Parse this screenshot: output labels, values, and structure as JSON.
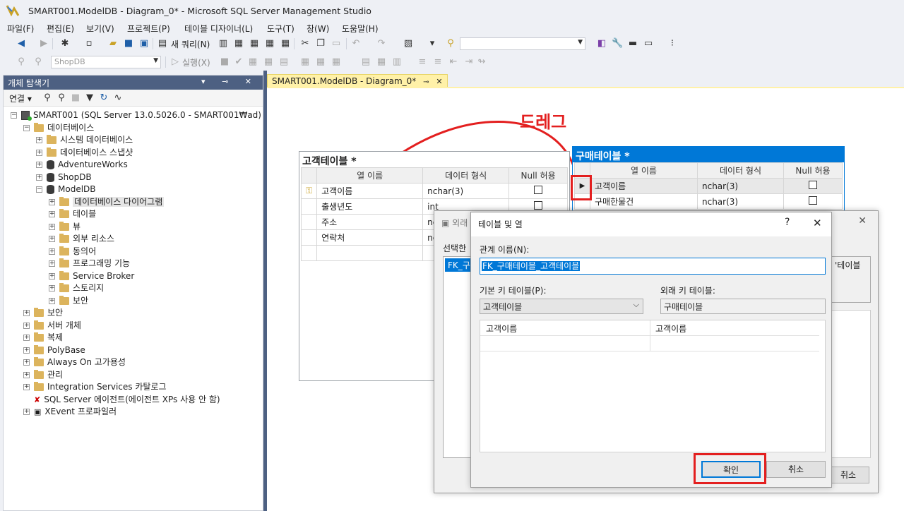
{
  "window": {
    "title": "SMART001.ModelDB - Diagram_0* - Microsoft SQL Server Management Studio"
  },
  "menu": [
    "파일(F)",
    "편집(E)",
    "보기(V)",
    "프로젝트(P)",
    "테이블 디자이너(L)",
    "도구(T)",
    "창(W)",
    "도움말(H)"
  ],
  "toolbar": {
    "new_query": "새 쿼리(N)",
    "execute": "실행(X)",
    "database": "ShopDB"
  },
  "object_explorer": {
    "title": "개체 탐색기",
    "connect": "연결",
    "nodes": [
      {
        "label": "SMART001 (SQL Server 13.0.5026.0 - SMART001₩ad)",
        "kind": "server",
        "level": 0,
        "exp": "−"
      },
      {
        "label": "데이터베이스",
        "kind": "folder",
        "level": 1,
        "exp": "−"
      },
      {
        "label": "시스템 데이터베이스",
        "kind": "folder",
        "level": 2,
        "exp": "+"
      },
      {
        "label": "데이터베이스 스냅샷",
        "kind": "folder",
        "level": 2,
        "exp": "+"
      },
      {
        "label": "AdventureWorks",
        "kind": "db",
        "level": 2,
        "exp": "+"
      },
      {
        "label": "ShopDB",
        "kind": "db",
        "level": 2,
        "exp": "+"
      },
      {
        "label": "ModelDB",
        "kind": "db",
        "level": 2,
        "exp": "−"
      },
      {
        "label": "데이터베이스 다이어그램",
        "kind": "folder",
        "level": 3,
        "exp": "+",
        "selected": true
      },
      {
        "label": "테이블",
        "kind": "folder",
        "level": 3,
        "exp": "+"
      },
      {
        "label": "뷰",
        "kind": "folder",
        "level": 3,
        "exp": "+"
      },
      {
        "label": "외부 리소스",
        "kind": "folder",
        "level": 3,
        "exp": "+"
      },
      {
        "label": "동의어",
        "kind": "folder",
        "level": 3,
        "exp": "+"
      },
      {
        "label": "프로그래밍 기능",
        "kind": "folder",
        "level": 3,
        "exp": "+"
      },
      {
        "label": "Service Broker",
        "kind": "folder",
        "level": 3,
        "exp": "+"
      },
      {
        "label": "스토리지",
        "kind": "folder",
        "level": 3,
        "exp": "+"
      },
      {
        "label": "보안",
        "kind": "folder",
        "level": 3,
        "exp": "+"
      },
      {
        "label": "보안",
        "kind": "folder",
        "level": 1,
        "exp": "+"
      },
      {
        "label": "서버 개체",
        "kind": "folder",
        "level": 1,
        "exp": "+"
      },
      {
        "label": "복제",
        "kind": "folder",
        "level": 1,
        "exp": "+"
      },
      {
        "label": "PolyBase",
        "kind": "folder",
        "level": 1,
        "exp": "+"
      },
      {
        "label": "Always On 고가용성",
        "kind": "folder",
        "level": 1,
        "exp": "+"
      },
      {
        "label": "관리",
        "kind": "folder",
        "level": 1,
        "exp": "+"
      },
      {
        "label": "Integration Services 카탈로그",
        "kind": "folder",
        "level": 1,
        "exp": "+"
      },
      {
        "label": "SQL Server 에이전트(에이전트 XPs 사용 안 함)",
        "kind": "agent",
        "level": 1,
        "exp": ""
      },
      {
        "label": "XEvent 프로파일러",
        "kind": "xevent",
        "level": 1,
        "exp": "+"
      }
    ]
  },
  "document_tab": {
    "label": "SMART001.ModelDB - Diagram_0*",
    "pin": "⊸",
    "close": "✕"
  },
  "annotation": {
    "drag_label": "드레그"
  },
  "customer_table": {
    "title": "고객테이블 *",
    "headers": [
      "열 이름",
      "데이터 형식",
      "Null 허용"
    ],
    "rows": [
      {
        "name": "고객이름",
        "type": "nchar(3)",
        "key": true
      },
      {
        "name": "출생년도",
        "type": "int"
      },
      {
        "name": "주소",
        "type": "nc"
      },
      {
        "name": "연락처",
        "type": "nc"
      }
    ]
  },
  "purchase_table": {
    "title": "구매테이블 *",
    "headers": [
      "열 이름",
      "데이터 형식",
      "Null 허용"
    ],
    "rows": [
      {
        "name": "고객이름",
        "type": "nchar(3)"
      },
      {
        "name": "구매한물건",
        "type": "nchar(3)"
      }
    ]
  },
  "fk_dialog_back": {
    "title": "외래",
    "selected_label": "선택한",
    "list_item": "FK_구",
    "desc_fragment": "'테이블",
    "cancel_fragment": "취소"
  },
  "tables_columns_dialog": {
    "title": "테이블 및 열",
    "help": "?",
    "close": "✕",
    "relationship_name_label": "관계 이름(N):",
    "relationship_name_value": "FK_구매테이블_고객테이블",
    "pk_table_label": "기본 키 테이블(P):",
    "pk_table_value": "고객테이블",
    "fk_table_label": "외래 키 테이블:",
    "fk_table_value": "구매테이블",
    "columns": [
      [
        "고객이름",
        "고객이름"
      ]
    ],
    "ok": "확인",
    "cancel": "취소"
  },
  "colors": {
    "highlight_red": "#e31f1f",
    "oe_header": "#4d6082",
    "tab_yellow": "#fff1a8",
    "selection_blue": "#0078d7"
  }
}
